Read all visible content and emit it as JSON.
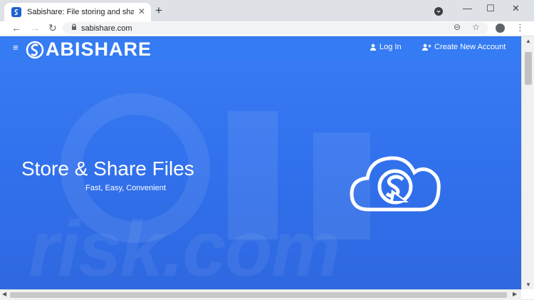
{
  "browser": {
    "tab_title": "Sabishare: File storing and sharing",
    "tab_close": "✕",
    "new_tab": "+",
    "url": "sabishare.com",
    "back_glyph": "←",
    "forward_glyph": "→",
    "reload_glyph": "↻",
    "minimize_glyph": "—",
    "maximize_glyph": "☐",
    "close_glyph": "✕",
    "zoom_glyph": "⊖",
    "star_glyph": "☆",
    "menu_glyph": "⋮"
  },
  "site": {
    "brand": "ABISHARE",
    "brand_letter": "S",
    "hamburger": "≡",
    "login": "Log In",
    "create_account": "Create New Account"
  },
  "hero": {
    "title": "Store & Share Files",
    "subtitle": "Fast, Easy, Convenient"
  },
  "watermark": "risk.com",
  "colors": {
    "page_blue": "#3272ee",
    "navbar_blue": "#357bf3",
    "white": "#ffffff"
  }
}
